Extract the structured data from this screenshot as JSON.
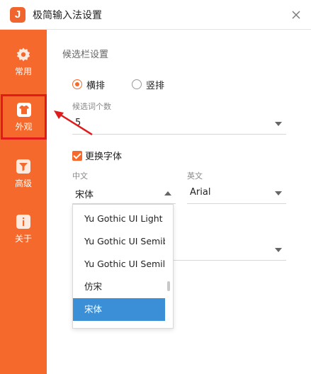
{
  "window": {
    "title": "极简输入法设置",
    "logo_text": "J",
    "close_icon": "close-icon"
  },
  "sidebar": {
    "items": [
      {
        "label": "常用",
        "icon": "gear-icon"
      },
      {
        "label": "外观",
        "icon": "shirt-icon"
      },
      {
        "label": "高级",
        "icon": "funnel-icon"
      },
      {
        "label": "关于",
        "icon": "info-icon"
      }
    ]
  },
  "candidate_bar": {
    "section_title": "候选栏设置",
    "layout_options": [
      {
        "label": "横排",
        "checked": true
      },
      {
        "label": "竖排",
        "checked": false
      }
    ],
    "count_label": "候选词个数",
    "count_value": "5",
    "font_checkbox_label": "更换字体",
    "chinese_label": "中文",
    "chinese_value": "宋体",
    "english_label": "英文",
    "english_value": "Arial",
    "font_options": [
      "Yu Gothic UI Light",
      "Yu Gothic UI Semib",
      "Yu Gothic UI Semili",
      "仿宋",
      "宋体"
    ],
    "selected_font": "宋体"
  },
  "colors": {
    "accent": "#f56a2c",
    "highlight": "#e11b1b",
    "selection": "#3b8fd6"
  }
}
